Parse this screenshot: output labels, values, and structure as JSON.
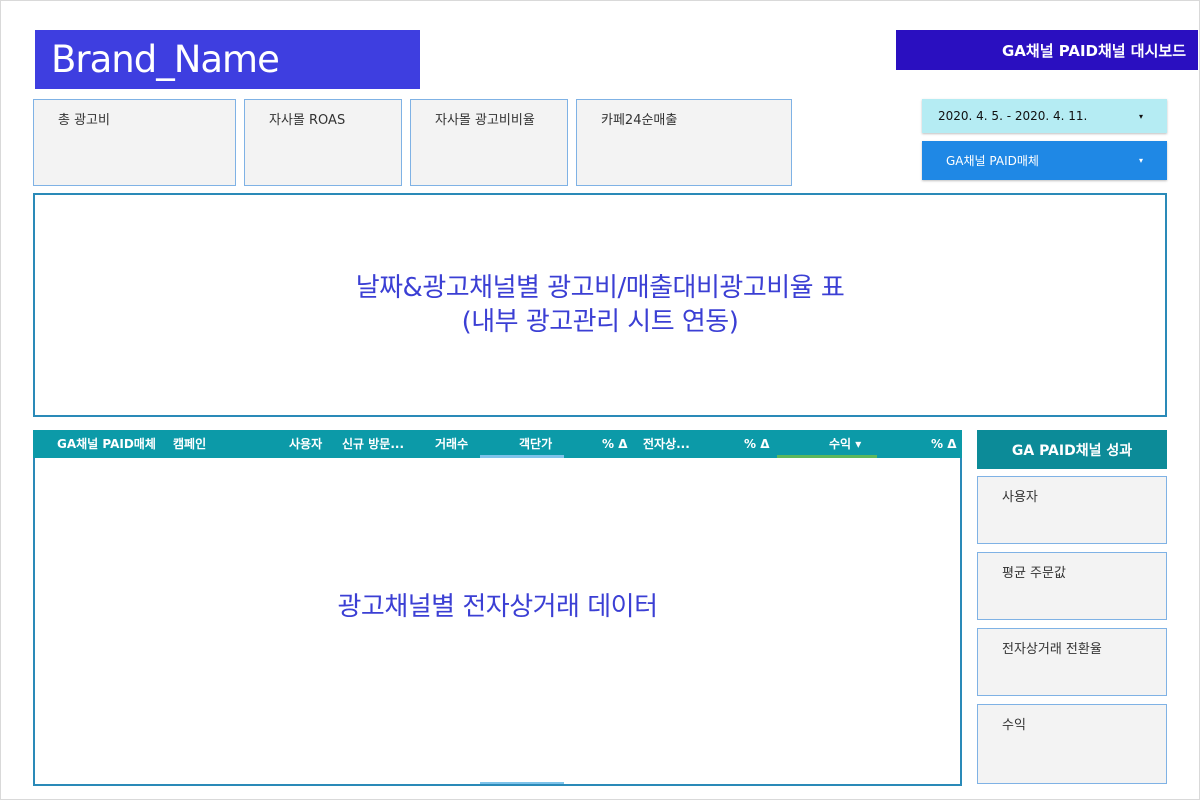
{
  "brand": {
    "name": "Brand_Name"
  },
  "dashboard": {
    "title": "GA채널 PAID채널 대시보드"
  },
  "scorecards": [
    {
      "label": "총 광고비"
    },
    {
      "label": "자사몰 ROAS"
    },
    {
      "label": "자사몰 광고비비율"
    },
    {
      "label": "카페24순매출"
    }
  ],
  "filters": {
    "date_range": "2020. 4. 5. - 2020. 4. 11.",
    "media": "GA채널 PAID매체",
    "caret_icon": "▾"
  },
  "placeholders": {
    "top_line1": "날짜&광고채널별 광고비/매출대비광고비율 표",
    "top_line2": "(내부 광고관리 시트 연동)",
    "bottom": "광고채널별 전자상거래 데이터"
  },
  "table": {
    "columns": [
      "GA채널 PAID매체",
      "캠페인",
      "사용자",
      "신규 방문...",
      "거래수",
      "객단가",
      "% Δ",
      "전자상...",
      "% Δ",
      "수익 ▾",
      "% Δ"
    ],
    "accent_colors": {
      "header": "#0c9aa8",
      "sort_underline": "#5cb85c",
      "col_underline": "#7ec3ea"
    }
  },
  "performance": {
    "title": "GA PAID채널 성과",
    "cards": [
      {
        "label": "사용자"
      },
      {
        "label": "평균 주문값"
      },
      {
        "label": "전자상거래 전환율"
      },
      {
        "label": "수익"
      }
    ]
  },
  "colors": {
    "brand_bg": "#3e3ee0",
    "title_bg": "#2a0fc0",
    "date_dropdown_bg": "#b5ecf3",
    "media_dropdown_bg": "#1f88e5",
    "placeholder_text": "#3b3fd4"
  }
}
